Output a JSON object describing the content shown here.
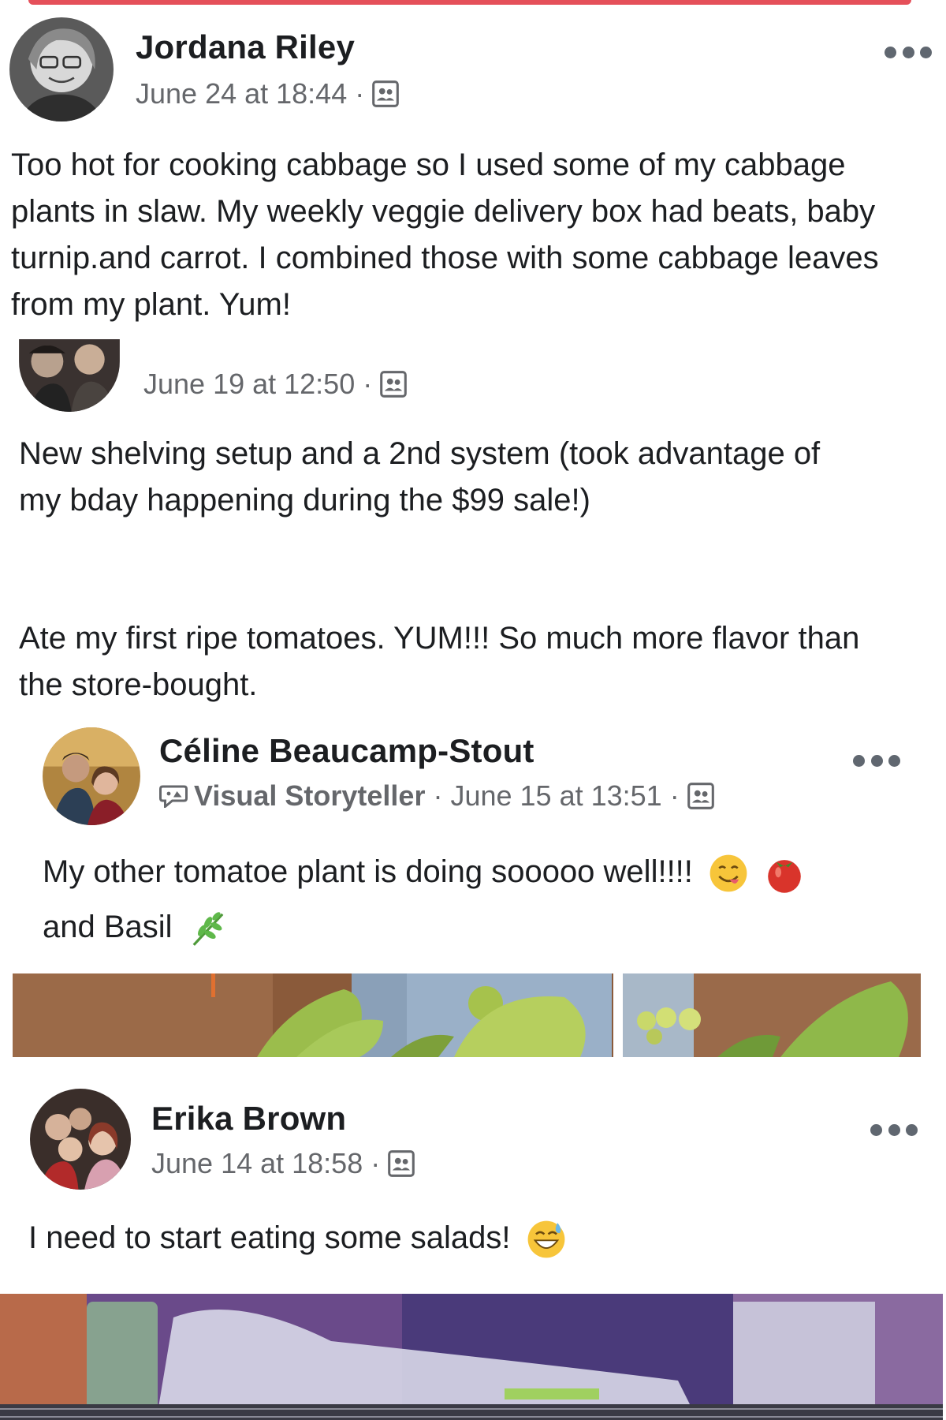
{
  "posts": [
    {
      "author": "Jordana Riley",
      "timestamp": "June 24 at 18:44",
      "separator": "·",
      "audience_icon": "friends-icon",
      "text": "Too hot for cooking cabbage so I used some of my cabbage plants in slaw.  My weekly veggie delivery box had beats, baby turnip.and carrot.  I combined those with some cabbage leaves from my plant.  Yum!"
    },
    {
      "author": "",
      "timestamp": "June 19 at 12:50",
      "separator": "·",
      "audience_icon": "friends-icon",
      "text_paragraph_1": "New shelving setup and a 2nd system (took advantage of my bday happening during the $99 sale!)",
      "text_paragraph_2": "Ate my first ripe tomatoes. YUM!!! So much more flavor than the store-bought."
    },
    {
      "author": "Céline Beaucamp-Stout",
      "badge": "Visual Storyteller",
      "badge_icon": "speech-bubble-icon",
      "timestamp": "June 15 at 13:51",
      "separator": "·",
      "audience_icon": "friends-icon",
      "text_line_1": "My other tomatoe plant is doing sooooo well!!!!",
      "text_line_2": "and Basil",
      "emojis": [
        "yum-face-emoji",
        "tomato-emoji",
        "herb-emoji"
      ]
    },
    {
      "author": "Erika Brown",
      "timestamp": "June 14 at 18:58",
      "separator": "·",
      "audience_icon": "friends-icon",
      "text": "I need to start eating some salads!",
      "emojis": [
        "sweat-smile-emoji"
      ]
    }
  ],
  "colors": {
    "top_bar": "#e5505a",
    "meta_text": "#65676b",
    "body_text": "#1c1e21"
  }
}
